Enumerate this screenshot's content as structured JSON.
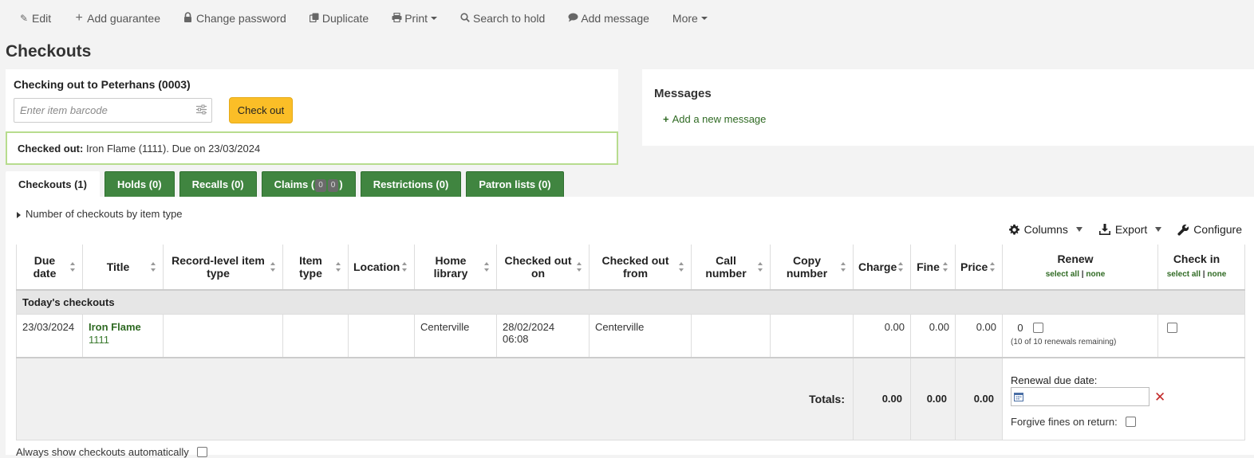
{
  "toolbar": {
    "edit": "Edit",
    "add_guarantee": "Add guarantee",
    "change_password": "Change password",
    "duplicate": "Duplicate",
    "print": "Print",
    "search_to_hold": "Search to hold",
    "add_message": "Add message",
    "more": "More"
  },
  "page_title": "Checkouts",
  "checkout": {
    "heading": "Checking out to Peterhans (0003)",
    "barcode_placeholder": "Enter item barcode",
    "button": "Check out",
    "result_label": "Checked out:",
    "result_text": " Iron Flame (1111). Due on 23/03/2024"
  },
  "messages": {
    "title": "Messages",
    "add_link": "Add a new message"
  },
  "tabs": {
    "checkouts": "Checkouts (1)",
    "holds": "Holds (0)",
    "recalls": "Recalls (0)",
    "claims_prefix": "Claims (",
    "claims_a": "0",
    "claims_b": "0",
    "claims_suffix": ")",
    "restrictions": "Restrictions (0)",
    "patron_lists": "Patron lists (0)"
  },
  "summary_toggle": "Number of checkouts by item type",
  "table_tools": {
    "columns": "Columns",
    "export": "Export",
    "configure": "Configure"
  },
  "columns": {
    "due_date": [
      "Due",
      "date"
    ],
    "title": "Title",
    "record_type": [
      "Record-level item",
      "type"
    ],
    "item_type": [
      "Item",
      "type"
    ],
    "location": "Location",
    "home_library": [
      "Home",
      "library"
    ],
    "checked_out_on": [
      "Checked out",
      "on"
    ],
    "checked_out_from": [
      "Checked out",
      "from"
    ],
    "call_number": [
      "Call",
      "number"
    ],
    "copy_number": [
      "Copy",
      "number"
    ],
    "charge": "Charge",
    "fine": "Fine",
    "price": "Price",
    "renew": "Renew",
    "check_in": "Check in",
    "select_all": "select all",
    "separator": "|",
    "none": "none"
  },
  "group_label": "Today's checkouts",
  "row": {
    "due_date": "23/03/2024",
    "title": "Iron Flame",
    "barcode": "1111",
    "home_library": "Centerville",
    "checked_out_on": "28/02/2024 06:08",
    "checked_out_from": "Centerville",
    "charge": "0.00",
    "fine": "0.00",
    "price": "0.00",
    "renew_count": "0",
    "renewals_remaining": "(10 of 10 renewals remaining)"
  },
  "totals": {
    "label": "Totals:",
    "charge": "0.00",
    "fine": "0.00",
    "price": "0.00"
  },
  "renew_options": {
    "due_date_label": "Renewal due date:",
    "forgive_label": "Forgive fines on return:"
  },
  "always_show": "Always show checkouts automatically",
  "colors": {
    "tab_green": "#408540",
    "link_green": "#2f6a23",
    "checkout_button": "#fbbe27",
    "success_border": "#b7dc8e"
  }
}
